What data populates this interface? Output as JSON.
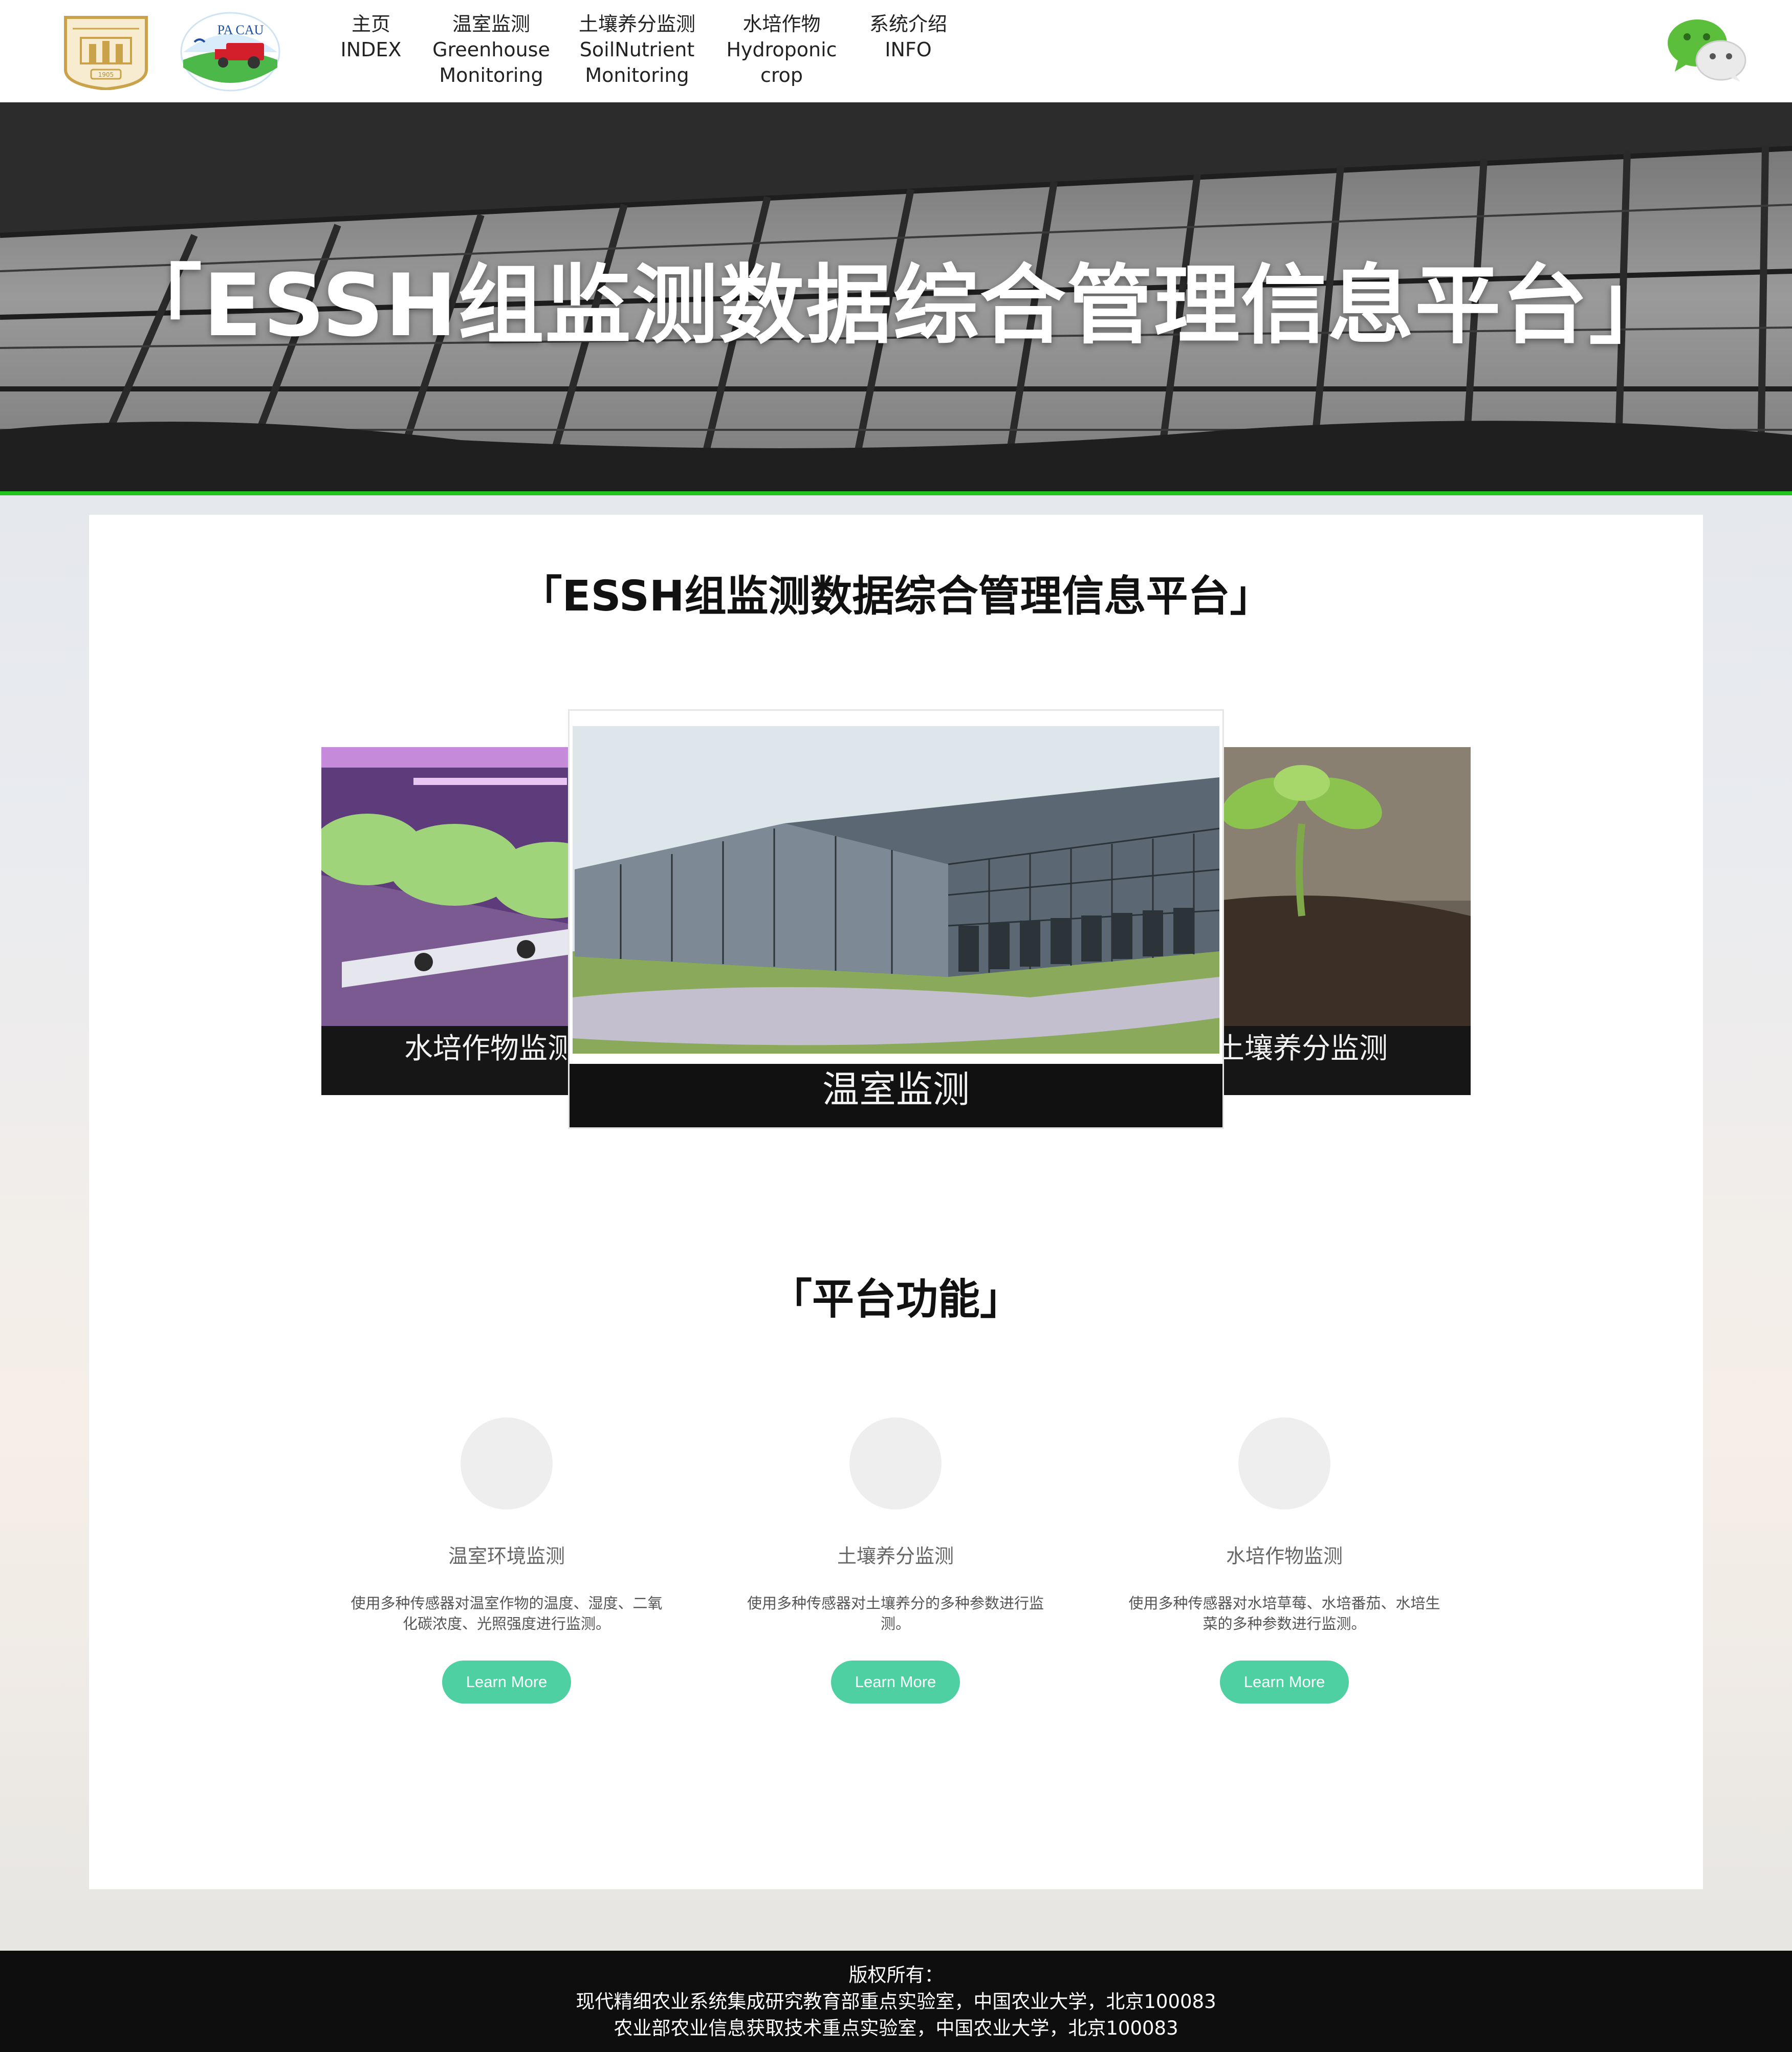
{
  "header": {
    "nav": [
      {
        "zh": "主页",
        "en1": "INDEX",
        "en2": ""
      },
      {
        "zh": "温室监测",
        "en1": "Greenhouse",
        "en2": "Monitoring"
      },
      {
        "zh": "土壤养分监测",
        "en1": "SoilNutrient",
        "en2": "Monitoring"
      },
      {
        "zh": "水培作物",
        "en1": "Hydroponic",
        "en2": "crop"
      },
      {
        "zh": "系统介绍",
        "en1": "INFO",
        "en2": ""
      }
    ],
    "logo_pacau_text": "PA CAU",
    "logo_cau_year": "1905"
  },
  "hero": {
    "title": "「ESSH组监测数据综合管理信息平台」"
  },
  "main": {
    "title": "「ESSH组监测数据综合管理信息平台」",
    "carousel": {
      "left_caption": "水培作物监测",
      "center_caption": "温室监测",
      "right_caption": "土壤养分监测"
    },
    "features_title": "「平台功能」",
    "features": [
      {
        "title": "温室环境监测",
        "desc": "使用多种传感器对温室作物的温度、湿度、二氧化碳浓度、光照强度进行监测。",
        "button": "Learn More"
      },
      {
        "title": "土壤养分监测",
        "desc": "使用多种传感器对土壤养分的多种参数进行监测。",
        "button": "Learn More"
      },
      {
        "title": "水培作物监测",
        "desc": "使用多种传感器对水培草莓、水培番茄、水培生菜的多种参数进行监测。",
        "button": "Learn More"
      }
    ]
  },
  "footer": {
    "line1": "版权所有：",
    "line2": "现代精细农业系统集成研究教育部重点实验室，中国农业大学，北京100083",
    "line3": "农业部农业信息获取技术重点实验室，中国农业大学，北京100083"
  },
  "colors": {
    "accent_green": "#22c421",
    "button": "#4fd0a3",
    "footer_bg": "#0e0e0e"
  }
}
